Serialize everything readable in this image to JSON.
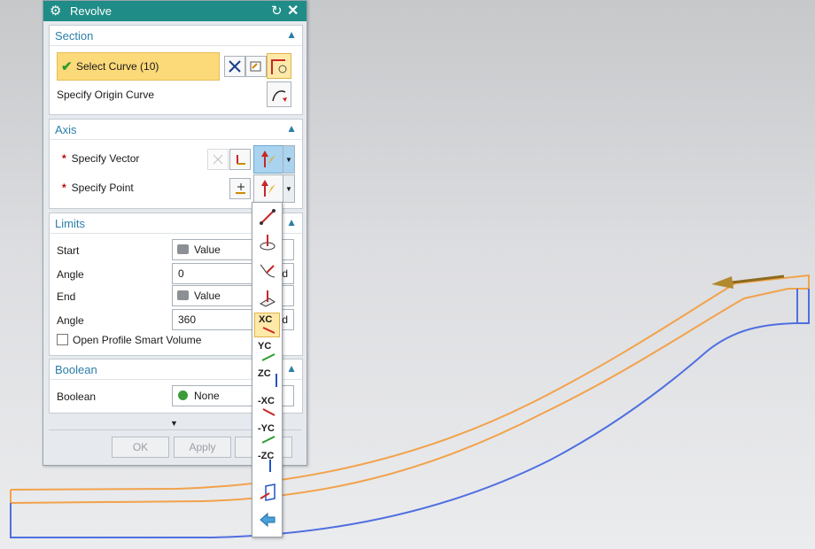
{
  "dialog": {
    "title": "Revolve",
    "icons": {
      "settings": "gear-icon",
      "reset": "reset-icon",
      "close": "close-icon"
    }
  },
  "section": {
    "title": "Section",
    "select_curve": "Select Curve (10)",
    "origin_curve": "Specify Origin Curve"
  },
  "axis": {
    "title": "Axis",
    "specify_vector": "Specify Vector",
    "specify_point": "Specify Point",
    "required_mark": "*"
  },
  "limits": {
    "title": "Limits",
    "start_label": "Start",
    "start_value": "Value",
    "angle1_label": "Angle",
    "angle1_value": "0",
    "end_label": "End",
    "end_value": "Value",
    "angle2_label": "Angle",
    "angle2_value": "360",
    "unit": "d",
    "open_profile": "Open Profile Smart Volume"
  },
  "boolean": {
    "title": "Boolean",
    "label": "Boolean",
    "value": "None"
  },
  "buttons": {
    "ok": "OK",
    "apply": "Apply",
    "cancel": "C"
  },
  "palette": {
    "items": [
      "XC",
      "YC",
      "ZC",
      "-XC",
      "-YC",
      "-ZC"
    ]
  },
  "colors": {
    "title_bar": "#1f8c87",
    "group_title": "#2b7ea8",
    "selection": "#fcd979",
    "curve_orange": "#f2a24a",
    "curve_blue": "#4f6fe0"
  }
}
